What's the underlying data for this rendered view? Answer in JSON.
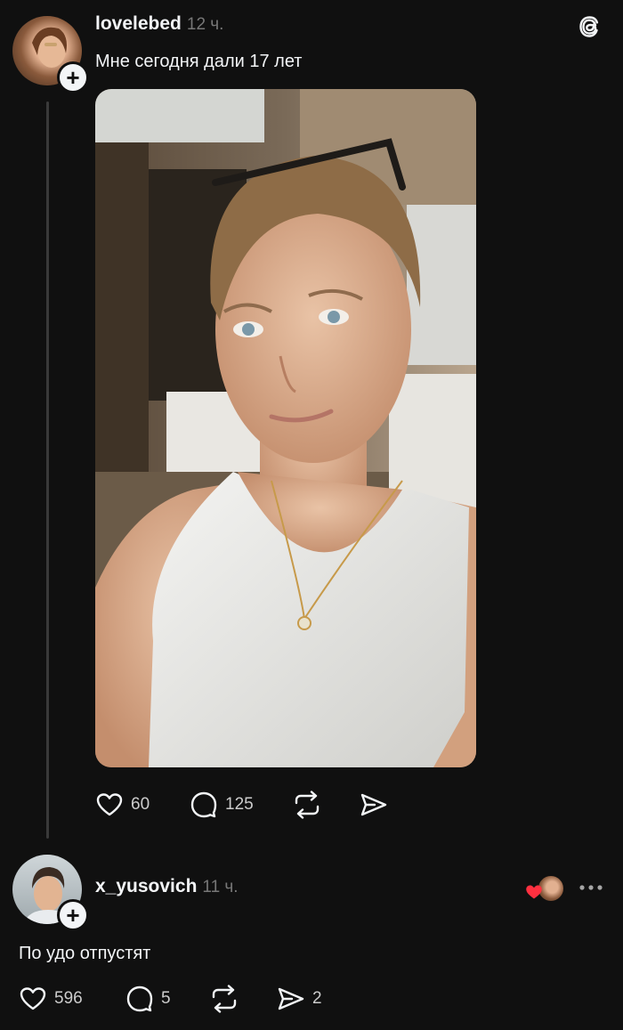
{
  "post": {
    "username": "lovelebed",
    "time": "12 ч.",
    "text": "Мне сегодня дали 17 лет",
    "likes": "60",
    "comments": "125"
  },
  "reply": {
    "username": "x_yusovich",
    "time": "11 ч.",
    "text": "По удо отпустят",
    "likes": "596",
    "comments": "5",
    "shares": "2"
  },
  "colors": {
    "background": "#101010",
    "text": "#f3f5f7",
    "muted": "#777777",
    "like_red": "#ff3040"
  },
  "icons": [
    "threads-logo-icon",
    "heart-icon",
    "comment-icon",
    "repost-icon",
    "share-icon",
    "more-icon",
    "plus-icon"
  ]
}
